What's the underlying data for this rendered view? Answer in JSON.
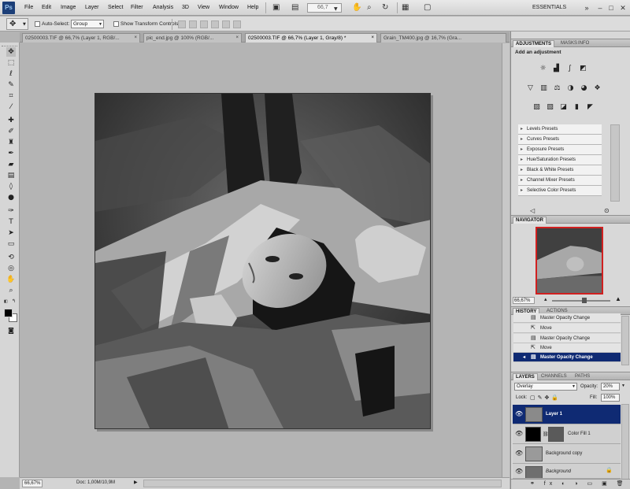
{
  "app": {
    "logo": "Ps"
  },
  "menus": [
    "File",
    "Edit",
    "Image",
    "Layer",
    "Select",
    "Filter",
    "Analysis",
    "3D",
    "View",
    "Window",
    "Help"
  ],
  "menubar": {
    "zoom": "66,7",
    "workspace": "ESSENTIALS"
  },
  "options": {
    "auto_select_label": "Auto-Select:",
    "auto_select_value": "Group",
    "transform_label": "Show Transform Controls"
  },
  "tabs": [
    {
      "label": "02500003.TIF @ 66,7% (Layer 1, RGB/..."
    },
    {
      "label": "pic_end.jpg @ 100% (RGB/..."
    },
    {
      "label": "02500003.TIF @ 66,7% (Layer 1, Gray/8) *",
      "active": true
    },
    {
      "label": "Grain_TM400.jpg @ 16,7% (Gra..."
    }
  ],
  "status": {
    "zoom": "66,67%",
    "doc": "Doc: 1,00M/10,9M"
  },
  "adjustments": {
    "tabs": [
      "ADJUSTMENTS",
      "MASKS",
      "INFO"
    ],
    "title": "Add an adjustment",
    "presets": [
      "Levels Presets",
      "Curves Presets",
      "Exposure Presets",
      "Hue/Saturation Presets",
      "Black & White Presets",
      "Channel Mixer Presets",
      "Selective Color Presets"
    ]
  },
  "navigator": {
    "tab": "NAVIGATOR",
    "zoom": "66,67%"
  },
  "history": {
    "tabs": [
      "HISTORY",
      "ACTIONS"
    ],
    "items": [
      {
        "label": "Master Opacity Change"
      },
      {
        "label": "Move"
      },
      {
        "label": "Master Opacity Change"
      },
      {
        "label": "Move"
      },
      {
        "label": "Master Opacity Change",
        "selected": true
      }
    ]
  },
  "layers": {
    "tabs": [
      "LAYERS",
      "CHANNELS",
      "PATHS"
    ],
    "blend_mode": "Overlay",
    "opacity_label": "Opacity:",
    "opacity": "20%",
    "lock_label": "Lock:",
    "fill_label": "Fill:",
    "fill": "100%",
    "items": [
      {
        "name": "Layer 1",
        "selected": true
      },
      {
        "name": "Color Fill 1"
      },
      {
        "name": "Background copy"
      },
      {
        "name": "Background"
      }
    ]
  },
  "colors": {
    "selection": "#0f2a73",
    "nav_box": "#d02020"
  }
}
